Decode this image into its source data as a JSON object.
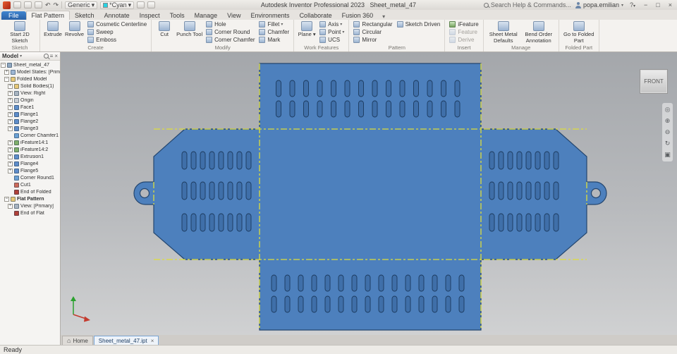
{
  "titlebar": {
    "app_title": "Autodesk Inventor Professional 2023",
    "doc_title": "Sheet_metal_47",
    "material_value": "Generic",
    "appearance_value": "*Cyan",
    "search_text": "Search Help & Commands...",
    "user_name": "popa.emilian",
    "accent_cyan": "#29d3e2"
  },
  "icons": {
    "dropdown": "▾",
    "undo": "↶",
    "redo": "↷",
    "close": "×",
    "minimize": "−",
    "maximize": "□",
    "help": "?",
    "home": "⌂",
    "list": "≡",
    "nav_wheel": "◎",
    "pan": "⊕",
    "zoom": "⊖",
    "orbit": "↻",
    "look_at": "▣"
  },
  "ribbon": {
    "tabs": [
      {
        "label": "File",
        "style": "file"
      },
      {
        "label": "Flat Pattern",
        "style": "active"
      },
      {
        "label": "Sketch"
      },
      {
        "label": "Annotate"
      },
      {
        "label": "Inspect"
      },
      {
        "label": "Tools"
      },
      {
        "label": "Manage"
      },
      {
        "label": "View"
      },
      {
        "label": "Environments"
      },
      {
        "label": "Collaborate"
      },
      {
        "label": "Fusion 360"
      }
    ],
    "groups": [
      {
        "label": "Sketch",
        "columns": [
          {
            "type": "big",
            "buttons": [
              {
                "label": "Start 2D Sketch",
                "icon": "start-2d-sketch-icon"
              }
            ]
          }
        ]
      },
      {
        "label": "Create",
        "columns": [
          {
            "type": "big",
            "buttons": [
              {
                "label": "Extrude",
                "icon": "extrude-icon"
              }
            ]
          },
          {
            "type": "big",
            "buttons": [
              {
                "label": "Revolve",
                "icon": "revolve-icon"
              }
            ]
          },
          {
            "type": "small",
            "buttons": [
              {
                "label": "Cosmetic Centerline",
                "icon": "cosmetic-centerline-icon"
              },
              {
                "label": "Sweep",
                "icon": "sweep-icon"
              },
              {
                "label": "Emboss",
                "icon": "emboss-icon"
              }
            ]
          }
        ]
      },
      {
        "label": "Modify",
        "columns": [
          {
            "type": "big",
            "buttons": [
              {
                "label": "Cut",
                "icon": "cut-icon"
              }
            ]
          },
          {
            "type": "big",
            "buttons": [
              {
                "label": "Punch Tool",
                "icon": "punch-tool-icon"
              }
            ]
          },
          {
            "type": "small",
            "buttons": [
              {
                "label": "Hole",
                "icon": "hole-icon"
              },
              {
                "label": "Corner Round",
                "icon": "corner-round-icon"
              },
              {
                "label": "Corner Chamfer",
                "icon": "corner-chamfer-icon"
              }
            ]
          },
          {
            "type": "small",
            "buttons": [
              {
                "label": "Fillet",
                "icon": "fillet-icon",
                "dropdown": true
              },
              {
                "label": "Chamfer",
                "icon": "chamfer-icon"
              },
              {
                "label": "Mark",
                "icon": "mark-icon"
              }
            ]
          }
        ]
      },
      {
        "label": "Work Features",
        "columns": [
          {
            "type": "big",
            "buttons": [
              {
                "label": "Plane",
                "icon": "plane-icon",
                "dropdown": true
              }
            ]
          },
          {
            "type": "small",
            "buttons": [
              {
                "label": "Axis",
                "icon": "axis-icon",
                "dropdown": true
              },
              {
                "label": "Point",
                "icon": "point-icon",
                "dropdown": true
              },
              {
                "label": "UCS",
                "icon": "ucs-icon"
              }
            ]
          }
        ]
      },
      {
        "label": "Pattern",
        "columns": [
          {
            "type": "small",
            "buttons": [
              {
                "label": "Rectangular",
                "icon": "rectangular-pattern-icon"
              },
              {
                "label": "Circular",
                "icon": "circular-pattern-icon"
              },
              {
                "label": "Mirror",
                "icon": "mirror-icon"
              }
            ]
          },
          {
            "type": "small",
            "buttons": [
              {
                "label": "Sketch Driven",
                "icon": "sketch-driven-icon"
              }
            ]
          }
        ]
      },
      {
        "label": "Insert",
        "columns": [
          {
            "type": "small",
            "buttons": [
              {
                "label": "iFeature",
                "icon": "ifeature-icon"
              },
              {
                "label": "Feature",
                "icon": "feature-icon",
                "disabled": true
              },
              {
                "label": "Derive",
                "icon": "derive-icon",
                "disabled": true
              }
            ]
          }
        ]
      },
      {
        "label": "Manage",
        "columns": [
          {
            "type": "big",
            "buttons": [
              {
                "label": "Sheet Metal Defaults",
                "icon": "sheet-metal-defaults-icon"
              }
            ]
          },
          {
            "type": "big",
            "buttons": [
              {
                "label": "Bend Order Annotation",
                "icon": "bend-order-annotation-icon"
              }
            ]
          }
        ]
      },
      {
        "label": "Folded Part",
        "columns": [
          {
            "type": "big",
            "buttons": [
              {
                "label": "Go to Folded Part",
                "icon": "go-to-folded-part-icon"
              }
            ]
          }
        ]
      }
    ]
  },
  "browser": {
    "panel_title": "Model",
    "items": [
      {
        "label": "Sheet_metal_47",
        "depth": 0,
        "expander": "-",
        "icon": "part-icon"
      },
      {
        "label": "Model States: [Primary]",
        "depth": 1,
        "expander": "+",
        "icon": "model-states-icon"
      },
      {
        "label": "Folded Model",
        "depth": 1,
        "expander": "-",
        "icon": "folder-icon"
      },
      {
        "label": "Solid Bodies(1)",
        "depth": 2,
        "expander": "+",
        "icon": "folder-icon"
      },
      {
        "label": "View: Right",
        "depth": 2,
        "expander": "+",
        "icon": "view-icon"
      },
      {
        "label": "Origin",
        "depth": 2,
        "expander": "+",
        "icon": "origin-icon"
      },
      {
        "label": "Face1",
        "depth": 2,
        "expander": "+",
        "icon": "face-icon"
      },
      {
        "label": "Flange1",
        "depth": 2,
        "expander": "+",
        "icon": "flange-icon"
      },
      {
        "label": "Flange2",
        "depth": 2,
        "expander": "+",
        "icon": "flange-icon"
      },
      {
        "label": "Flange3",
        "depth": 2,
        "expander": "+",
        "icon": "flange-icon"
      },
      {
        "label": "Corner Chamfer1",
        "depth": 2,
        "expander": "",
        "icon": "chamfer-icon"
      },
      {
        "label": "iFeature14:1",
        "depth": 2,
        "expander": "+",
        "icon": "ifeature-icon"
      },
      {
        "label": "iFeature14:2",
        "depth": 2,
        "expander": "+",
        "icon": "ifeature-icon"
      },
      {
        "label": "Extrusion1",
        "depth": 2,
        "expander": "+",
        "icon": "extrusion-icon"
      },
      {
        "label": "Flange4",
        "depth": 2,
        "expander": "+",
        "icon": "flange-icon"
      },
      {
        "label": "Flange5",
        "depth": 2,
        "expander": "+",
        "icon": "flange-icon"
      },
      {
        "label": "Corner Round1",
        "depth": 2,
        "expander": "",
        "icon": "round-icon"
      },
      {
        "label": "Cut1",
        "depth": 2,
        "expander": "",
        "icon": "cut-icon"
      },
      {
        "label": "End of Folded",
        "depth": 2,
        "expander": "",
        "icon": "eof-icon"
      },
      {
        "label": "Flat Pattern",
        "depth": 1,
        "expander": "-",
        "icon": "flat-pattern-icon",
        "bold": true
      },
      {
        "label": "View: [Primary]",
        "depth": 2,
        "expander": "+",
        "icon": "view-icon"
      },
      {
        "label": "End of Flat",
        "depth": 2,
        "expander": "",
        "icon": "eof-icon"
      }
    ]
  },
  "canvas": {
    "viewcube_label": "FRONT",
    "part_color": "#4d80bd",
    "bend_line_color": "#dede3a"
  },
  "doctabs": {
    "home_label": "Home",
    "doc_label": "Sheet_metal_47.ipt"
  },
  "statusbar": {
    "text": "Ready"
  }
}
